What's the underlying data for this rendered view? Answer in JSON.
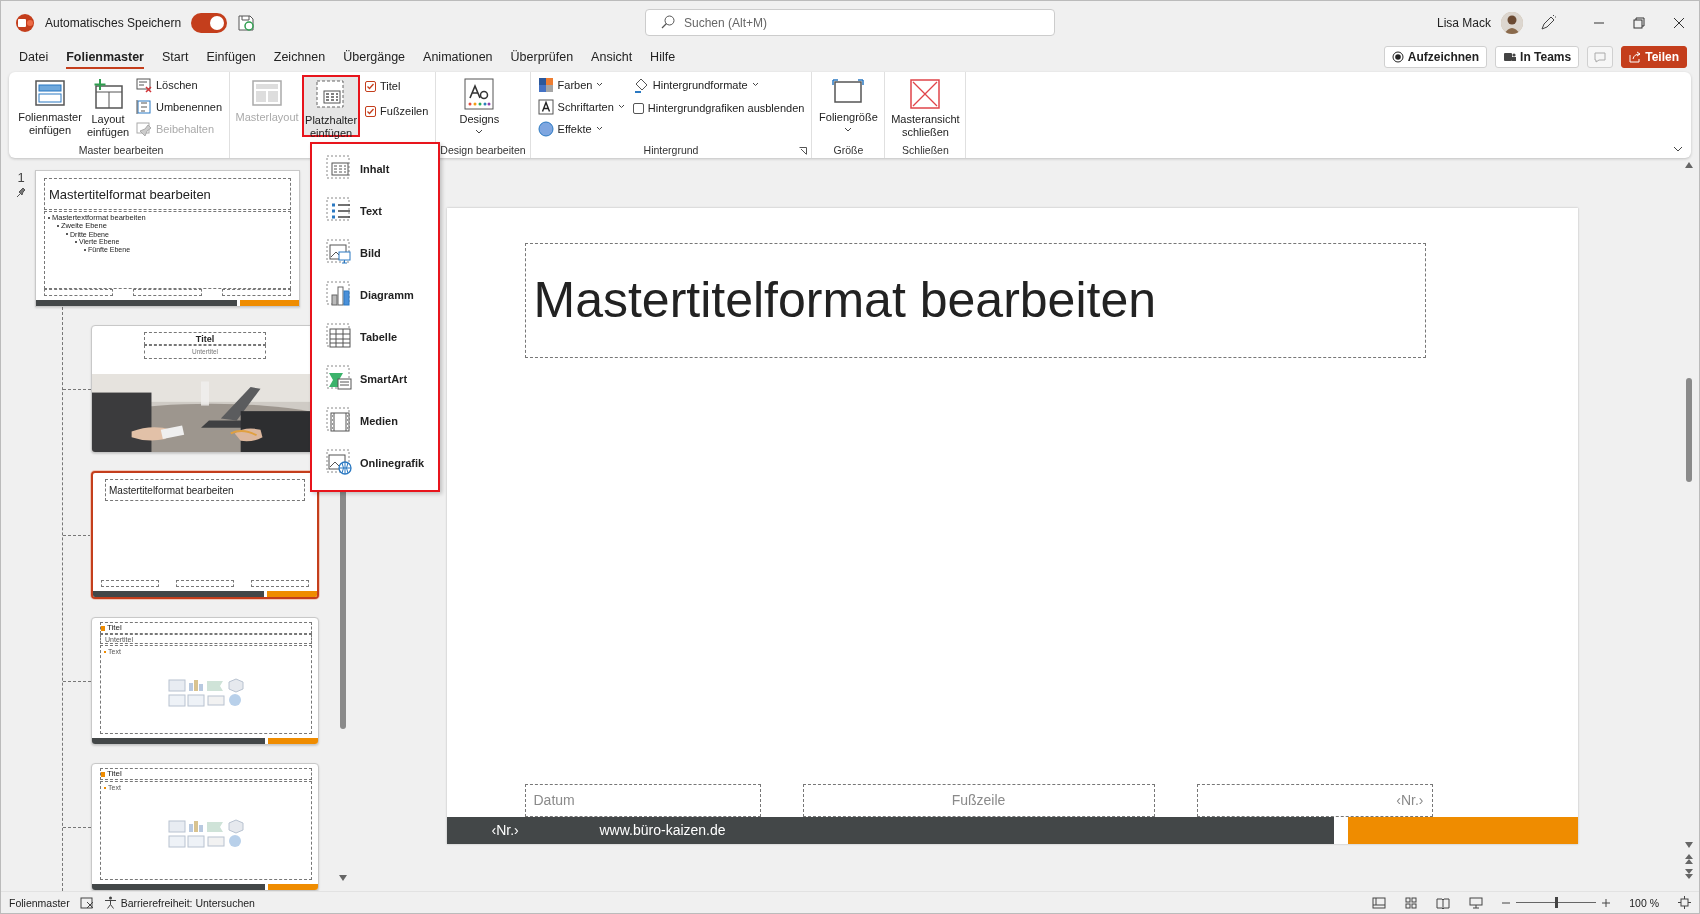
{
  "app_bar": {
    "autosave_label": "Automatisches Speichern",
    "autosave_on": true,
    "search_placeholder": "Suchen (Alt+M)",
    "user_name": "Lisa Mack"
  },
  "tabs": [
    {
      "label": "Datei",
      "selected": false
    },
    {
      "label": "Folienmaster",
      "selected": true
    },
    {
      "label": "Start",
      "selected": false
    },
    {
      "label": "Einfügen",
      "selected": false
    },
    {
      "label": "Zeichnen",
      "selected": false
    },
    {
      "label": "Übergänge",
      "selected": false
    },
    {
      "label": "Animationen",
      "selected": false
    },
    {
      "label": "Überprüfen",
      "selected": false
    },
    {
      "label": "Ansicht",
      "selected": false
    },
    {
      "label": "Hilfe",
      "selected": false
    }
  ],
  "actions": [
    {
      "kind": "record",
      "label": "Aufzeichnen"
    },
    {
      "kind": "teams",
      "label": "In Teams"
    },
    {
      "kind": "comments"
    },
    {
      "kind": "share",
      "label": "Teilen"
    }
  ],
  "ribbon": {
    "groups": [
      {
        "label": "Master bearbeiten",
        "columns": [
          [
            {
              "kind": "large",
              "label": "Folienmaster einfügen",
              "disabled": false
            }
          ],
          [
            {
              "kind": "large",
              "label": "Layout einfügen",
              "disabled": false
            }
          ],
          [
            {
              "kind": "small",
              "label": "Löschen",
              "disabled": false
            },
            {
              "kind": "small",
              "label": "Umbenennen",
              "disabled": false
            },
            {
              "kind": "small",
              "label": "Beibehalten",
              "disabled": true
            }
          ]
        ]
      },
      {
        "columns": [
          [
            {
              "kind": "large",
              "label": "Masterlayout",
              "disabled": true
            }
          ],
          [
            {
              "kind": "large",
              "label": "Platzhalter einfügen",
              "disabled": false,
              "dropdown": true,
              "outlined": true,
              "pressed": true
            }
          ],
          [
            {
              "kind": "check",
              "label": "Titel",
              "checked": true
            },
            {
              "kind": "check",
              "label": "Fußzeilen",
              "checked": true
            }
          ]
        ]
      },
      {
        "label": "Design bearbeiten",
        "columns": [
          [
            {
              "kind": "large",
              "label": "Designs",
              "disabled": false,
              "dropdown": true
            }
          ]
        ]
      },
      {
        "label": "Hintergrund",
        "launcher": true,
        "columns": [
          [
            {
              "kind": "small",
              "label": "Farben",
              "disabled": false,
              "dropdown": true
            },
            {
              "kind": "small",
              "label": "Schriftarten",
              "disabled": false,
              "dropdown": true
            },
            {
              "kind": "small",
              "label": "Effekte",
              "disabled": false,
              "dropdown": true
            }
          ],
          [
            {
              "kind": "small",
              "label": "Hintergrundformate",
              "disabled": false,
              "dropdown": true
            },
            {
              "kind": "check",
              "label": "Hintergrundgrafiken ausblenden",
              "checked": false
            }
          ]
        ]
      },
      {
        "label": "Größe",
        "columns": [
          [
            {
              "kind": "large",
              "label": "Foliengröße",
              "disabled": false,
              "dropdown": true
            }
          ]
        ]
      },
      {
        "label": "Schließen",
        "columns": [
          [
            {
              "kind": "large",
              "label": "Masteransicht schließen",
              "disabled": false
            }
          ]
        ]
      }
    ]
  },
  "placeholder_menu": {
    "items": [
      {
        "label": "Inhalt"
      },
      {
        "label": "Text"
      },
      {
        "label": "Bild"
      },
      {
        "label": "Diagramm"
      },
      {
        "label": "Tabelle"
      },
      {
        "label": "SmartArt"
      },
      {
        "label": "Medien"
      },
      {
        "label": "Onlinegrafik"
      }
    ]
  },
  "slide_panel": {
    "slide_number": "1",
    "thumbnails": [
      {
        "kind": "master",
        "selected": false,
        "title": "Mastertitelformat bearbeiten",
        "body": [
          {
            "text": "Mastertextformat bearbeiten",
            "children": [
              {
                "text": "Zweite Ebene",
                "children": [
                  {
                    "text": "Dritte Ebene",
                    "children": [
                      {
                        "text": "Vierte Ebene",
                        "children": [
                          {
                            "text": "Fünfte Ebene"
                          }
                        ]
                      }
                    ]
                  }
                ]
              }
            ]
          }
        ],
        "children": [
          {
            "kind": "title_photo",
            "selected": false,
            "title": "Titel",
            "subtitle": "Untertitel"
          },
          {
            "kind": "title_only",
            "selected": true,
            "title": "Mastertitelformat bearbeiten"
          },
          {
            "kind": "title_content",
            "selected": false,
            "title": "Titel",
            "subtitle": "Untertitel",
            "text": "Text"
          },
          {
            "kind": "content",
            "selected": false,
            "title": "Titel",
            "text": "Text"
          }
        ]
      }
    ]
  },
  "slide": {
    "title": "Mastertitelformat bearbeiten",
    "footer_date": "Datum",
    "footer_text": "Fußzeile",
    "footer_number": "‹Nr.›",
    "bar_number": "‹Nr.›",
    "bar_url": "www.büro-kaizen.de"
  },
  "status_bar": {
    "view": "Folienmaster",
    "accessibility": "Barrierefreiheit: Untersuchen",
    "zoom_slider": {
      "level": 0.5
    },
    "zoom": "100 %"
  }
}
